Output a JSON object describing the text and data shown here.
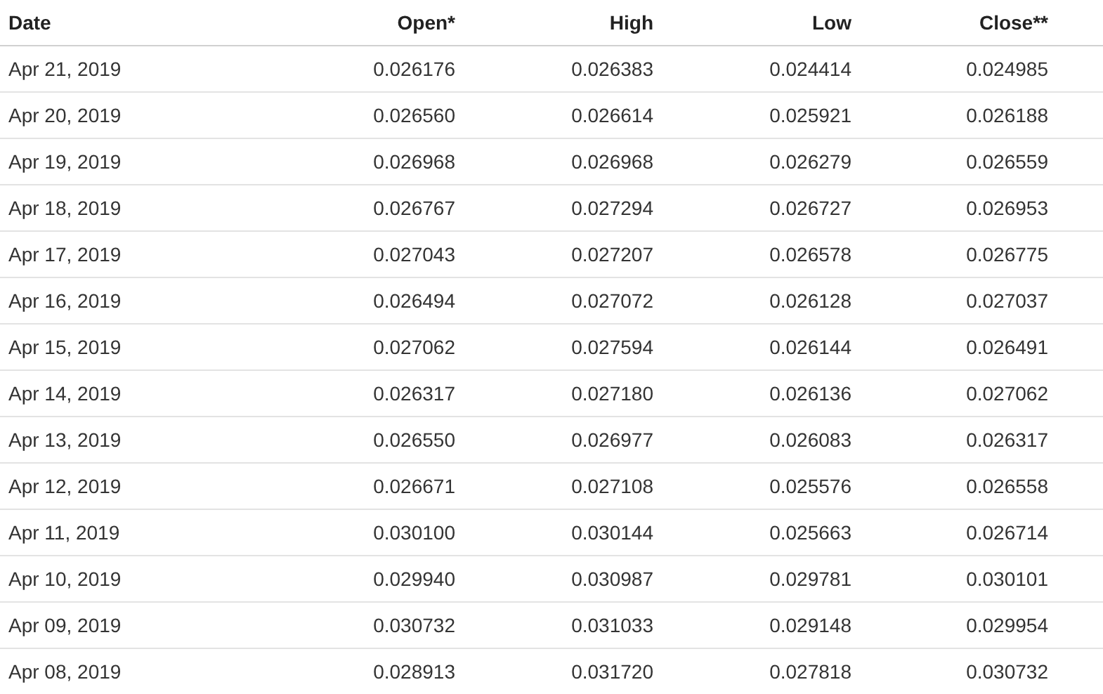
{
  "table": {
    "columns": [
      "Date",
      "Open*",
      "High",
      "Low",
      "Close**"
    ],
    "rows": [
      [
        "Apr 21, 2019",
        "0.026176",
        "0.026383",
        "0.024414",
        "0.024985"
      ],
      [
        "Apr 20, 2019",
        "0.026560",
        "0.026614",
        "0.025921",
        "0.026188"
      ],
      [
        "Apr 19, 2019",
        "0.026968",
        "0.026968",
        "0.026279",
        "0.026559"
      ],
      [
        "Apr 18, 2019",
        "0.026767",
        "0.027294",
        "0.026727",
        "0.026953"
      ],
      [
        "Apr 17, 2019",
        "0.027043",
        "0.027207",
        "0.026578",
        "0.026775"
      ],
      [
        "Apr 16, 2019",
        "0.026494",
        "0.027072",
        "0.026128",
        "0.027037"
      ],
      [
        "Apr 15, 2019",
        "0.027062",
        "0.027594",
        "0.026144",
        "0.026491"
      ],
      [
        "Apr 14, 2019",
        "0.026317",
        "0.027180",
        "0.026136",
        "0.027062"
      ],
      [
        "Apr 13, 2019",
        "0.026550",
        "0.026977",
        "0.026083",
        "0.026317"
      ],
      [
        "Apr 12, 2019",
        "0.026671",
        "0.027108",
        "0.025576",
        "0.026558"
      ],
      [
        "Apr 11, 2019",
        "0.030100",
        "0.030144",
        "0.025663",
        "0.026714"
      ],
      [
        "Apr 10, 2019",
        "0.029940",
        "0.030987",
        "0.029781",
        "0.030101"
      ],
      [
        "Apr 09, 2019",
        "0.030732",
        "0.031033",
        "0.029148",
        "0.029954"
      ],
      [
        "Apr 08, 2019",
        "0.028913",
        "0.031720",
        "0.027818",
        "0.030732"
      ]
    ]
  }
}
